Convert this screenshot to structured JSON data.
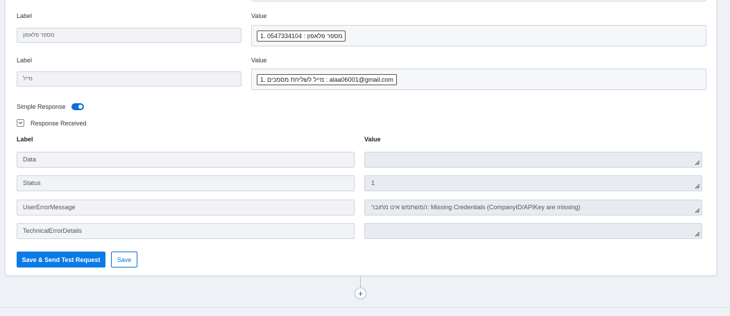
{
  "mappings": [
    {
      "label_caption": "Label",
      "value_caption": "Value",
      "label": "מספר פלאפון",
      "value_chip": "1. מספר פלאפון : 0547334104"
    },
    {
      "label_caption": "Label",
      "value_caption": "Value",
      "label": "מייל",
      "value_chip": "1. מייל לשליחת מסמכים : alaa06001@gmail.com"
    }
  ],
  "simple_response": {
    "label": "Simple Response",
    "enabled": true
  },
  "response_received": {
    "label": "Response Received",
    "expanded": true
  },
  "response_table": {
    "label_header": "Label",
    "value_header": "Value",
    "rows": [
      {
        "label": "Data",
        "value": ""
      },
      {
        "label": "Status",
        "value": "1"
      },
      {
        "label": "UserErrorMessage",
        "value": "המשתמש אינו מחובר: Missing Credentials (CompanyID/APIKey are missing)"
      },
      {
        "label": "TechnicalErrorDetails",
        "value": ""
      }
    ]
  },
  "buttons": {
    "save_send": "Save & Send Test Request",
    "save": "Save"
  },
  "add_step": "+",
  "colors": {
    "accent": "#0b7ae6",
    "toggle_on": "#0b6fd6",
    "page_bg": "#eef1f5"
  }
}
